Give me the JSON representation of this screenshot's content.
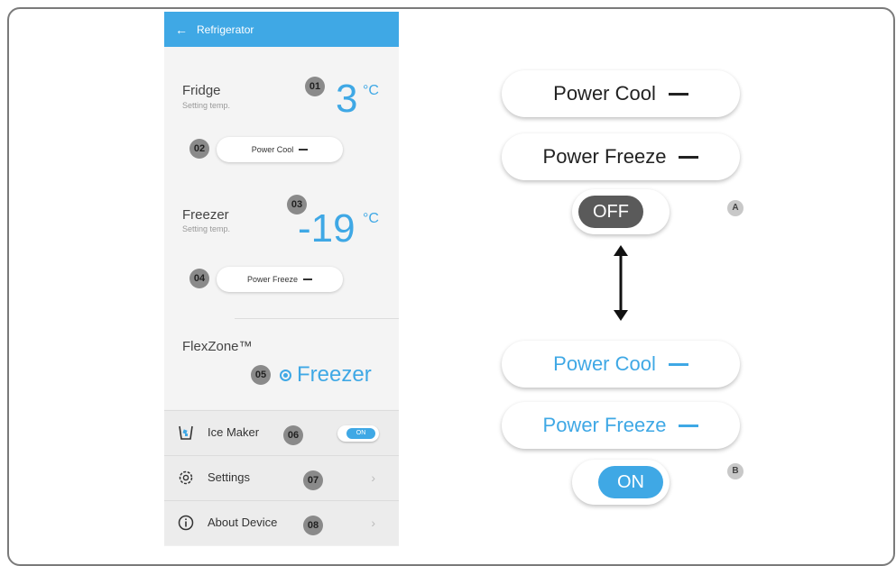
{
  "app": {
    "title": "Refrigerator"
  },
  "fridge": {
    "label": "Fridge",
    "sub": "Setting temp.",
    "badge": "01",
    "temp": "3",
    "unit": "°C"
  },
  "power_cool": {
    "badge": "02",
    "label": "Power Cool"
  },
  "freezer": {
    "label": "Freezer",
    "sub": "Setting temp.",
    "badge": "03",
    "temp": "-19",
    "unit": "°C"
  },
  "power_freeze": {
    "badge": "04",
    "label": "Power Freeze"
  },
  "flexzone": {
    "label": "FlexZone™",
    "badge": "05",
    "value": "Freezer"
  },
  "ice_maker": {
    "label": "Ice Maker",
    "badge": "06",
    "toggle": "ON"
  },
  "settings": {
    "label": "Settings",
    "badge": "07"
  },
  "about": {
    "label": "About Device",
    "badge": "08"
  },
  "panel_a": {
    "cool": "Power Cool",
    "freeze": "Power Freeze",
    "toggle": "OFF",
    "letter": "A"
  },
  "panel_b": {
    "cool": "Power Cool",
    "freeze": "Power Freeze",
    "toggle": "ON",
    "letter": "B"
  },
  "colors": {
    "accent": "#3fa8e5",
    "off_knob": "#5a5a5a"
  }
}
